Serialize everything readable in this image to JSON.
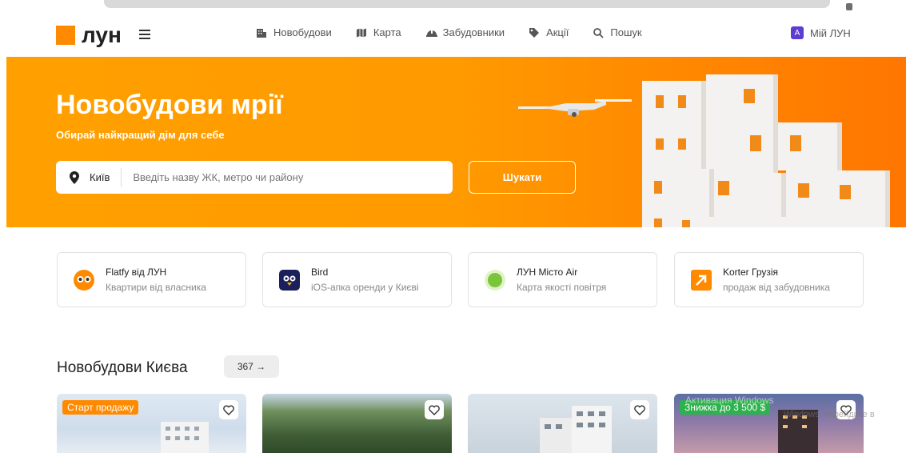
{
  "brand": {
    "logo_text": "лун"
  },
  "nav": [
    {
      "label": "Новобудови",
      "icon": "building-icon"
    },
    {
      "label": "Карта",
      "icon": "map-icon"
    },
    {
      "label": "Забудовники",
      "icon": "helmet-icon"
    },
    {
      "label": "Акції",
      "icon": "tag-icon"
    },
    {
      "label": "Пошук",
      "icon": "search-icon"
    }
  ],
  "account": {
    "avatar_letter": "А",
    "label": "Мій ЛУН"
  },
  "hero": {
    "title": "Новобудови мрії",
    "subtitle": "Обирай найкращий дім для себе",
    "city": "Київ",
    "search_placeholder": "Введіть назву ЖК, метро чи району",
    "search_button": "Шукати"
  },
  "services": [
    {
      "name": "Flatfy від ЛУН",
      "desc": "Квартири від власника",
      "icon": "owl-icon"
    },
    {
      "name": "Bird",
      "desc": "iOS-апка оренди у Києві",
      "icon": "bird-icon"
    },
    {
      "name": "ЛУН Місто Air",
      "desc": "Карта якості повітря",
      "icon": "air-dot-icon"
    },
    {
      "name": "Korter Грузія",
      "desc": "продаж від забудовника",
      "icon": "arrow-up-right-icon"
    }
  ],
  "listing": {
    "title": "Новобудови Києва",
    "count": "367 →",
    "cards": [
      {
        "badge": "Старт продажу"
      },
      {
        "badge": ""
      },
      {
        "badge": ""
      },
      {
        "badge": "Знижка до 3 500 $"
      }
    ]
  },
  "colors": {
    "accent": "#ff8a00",
    "badge_orange": "#ff8a00",
    "badge_green": "#2eb24e"
  },
  "os_watermark": {
    "line1": "Активация Windows",
    "line2": "Windows, перейдите в"
  }
}
